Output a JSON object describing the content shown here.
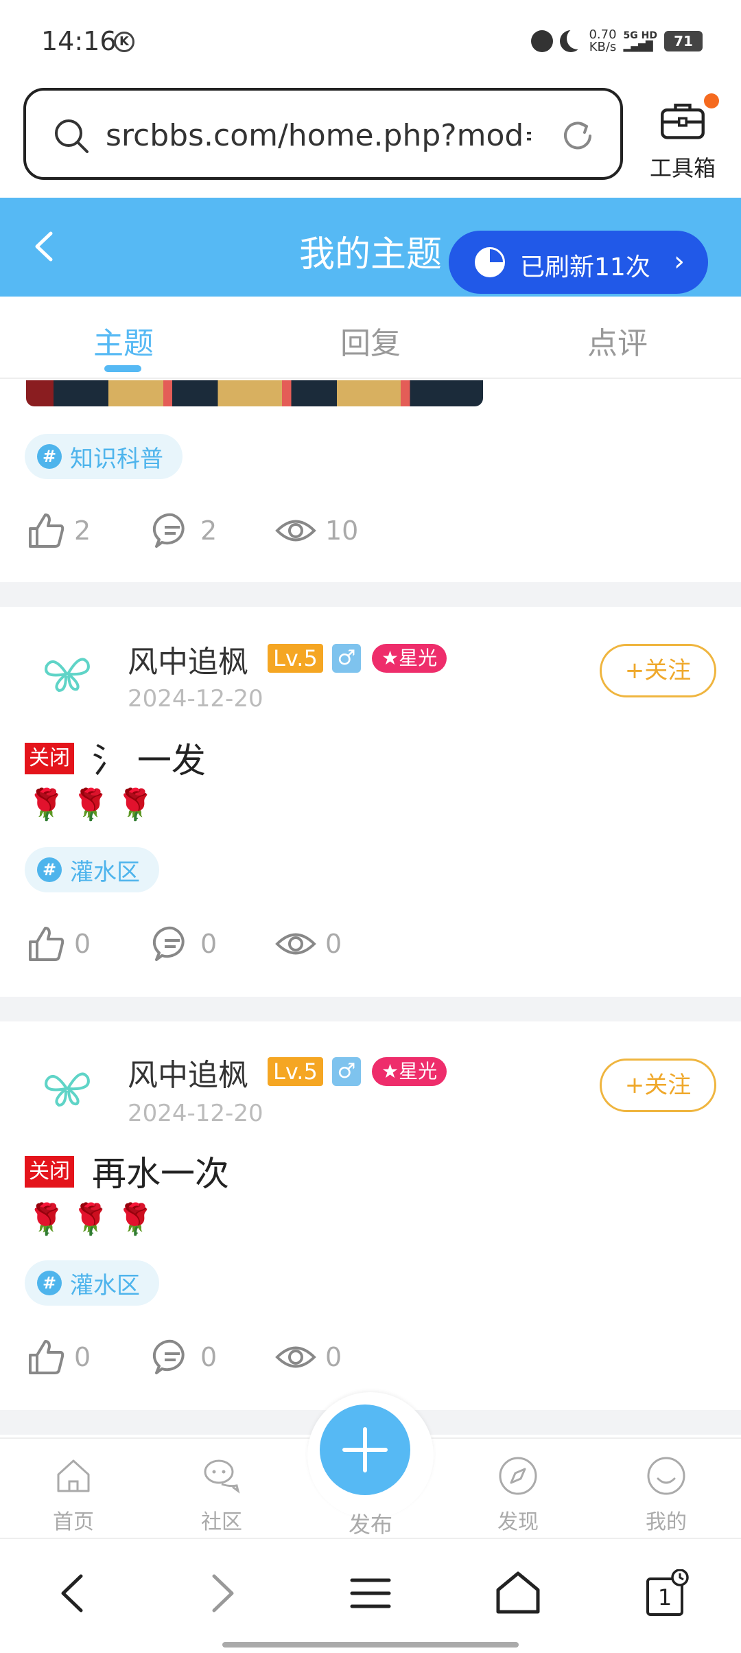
{
  "status_bar": {
    "time": "14:16",
    "k_icon": "K",
    "speed_value": "0.70",
    "speed_unit": "KB/s",
    "network_top": "5G HD",
    "battery": "71"
  },
  "browser": {
    "url": "srcbbs.com/home.php?mod=…",
    "toolbox_label": "工具箱"
  },
  "header": {
    "title": "我的主题",
    "refresh_label": "已刷新11次"
  },
  "tabs": [
    {
      "label": "主题",
      "active": true
    },
    {
      "label": "回复",
      "active": false
    },
    {
      "label": "点评",
      "active": false
    }
  ],
  "posts": [
    {
      "tag": "知识科普",
      "likes": "2",
      "comments": "2",
      "views": "10"
    },
    {
      "author": "风中追枫",
      "level": "Lv.5",
      "gender": "♂",
      "badge": "★星光",
      "date": "2024-12-20",
      "follow": "+关注",
      "closed": "关闭",
      "title": "氵 一发",
      "roses": "🌹🌹🌹",
      "tag": "灌水区",
      "likes": "0",
      "comments": "0",
      "views": "0"
    },
    {
      "author": "风中追枫",
      "level": "Lv.5",
      "gender": "♂",
      "badge": "★星光",
      "date": "2024-12-20",
      "follow": "+关注",
      "closed": "关闭",
      "title": "再水一次",
      "roses": "🌹🌹🌹",
      "tag": "灌水区",
      "likes": "0",
      "comments": "0",
      "views": "0"
    }
  ],
  "app_nav": [
    {
      "label": "首页",
      "icon": "home-icon"
    },
    {
      "label": "社区",
      "icon": "community-icon"
    },
    {
      "label": "发布",
      "icon": "plus-icon"
    },
    {
      "label": "发现",
      "icon": "compass-icon"
    },
    {
      "label": "我的",
      "icon": "smile-icon"
    }
  ],
  "browser_nav": {
    "tabs_count": "1"
  },
  "colors": {
    "accent": "#56b9f4",
    "refresh_pill": "#2159e8",
    "level_badge": "#f5a623",
    "star_badge": "#ee2d6b",
    "closed_badge": "#e4141b",
    "follow": "#efa82b"
  }
}
